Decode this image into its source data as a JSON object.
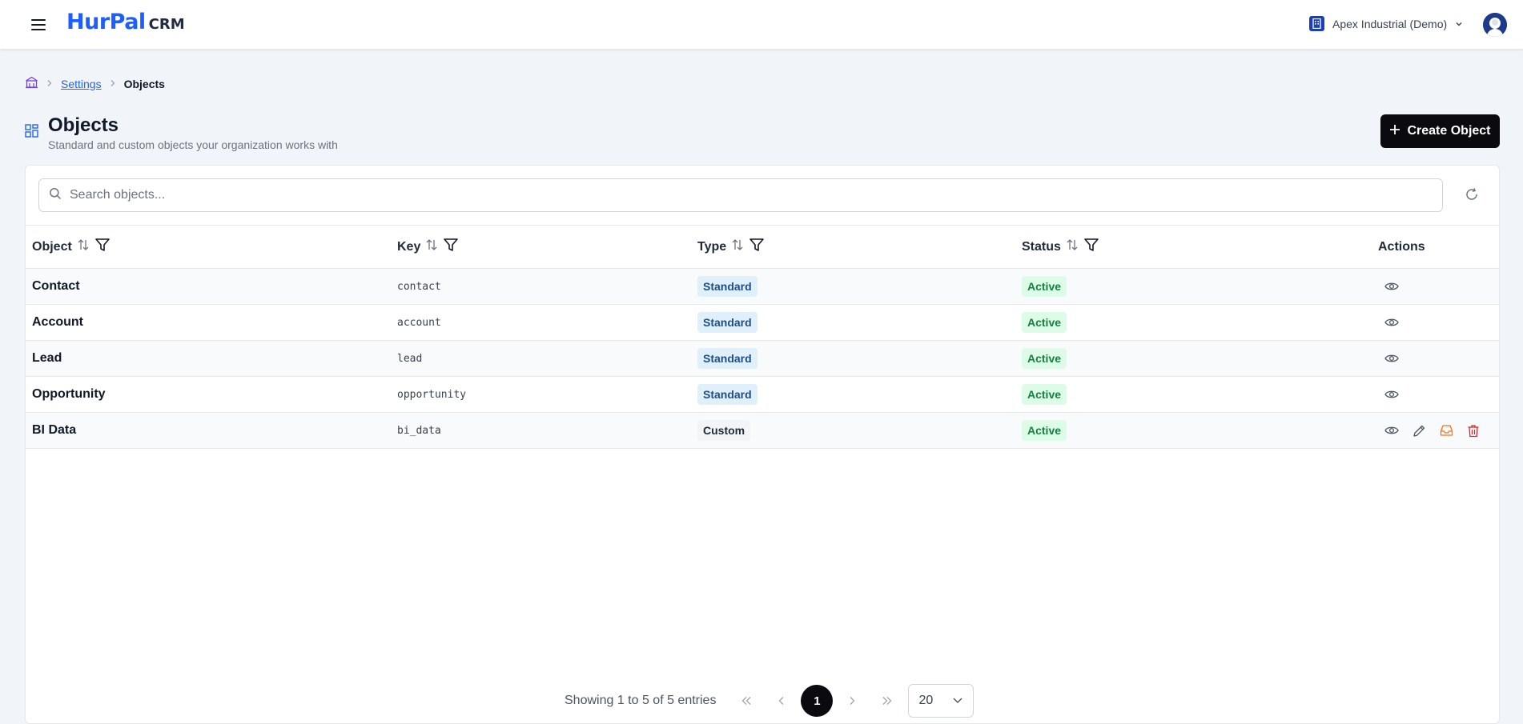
{
  "header": {
    "logo_brand": "HurPal",
    "logo_suffix": "CRM",
    "org_name": "Apex Industrial (Demo)"
  },
  "breadcrumb": {
    "settings": "Settings",
    "current": "Objects"
  },
  "page": {
    "title": "Objects",
    "subtitle": "Standard and custom objects your organization works with",
    "create_label": "Create Object"
  },
  "search": {
    "placeholder": "Search objects...",
    "value": ""
  },
  "table": {
    "columns": [
      "Object",
      "Key",
      "Type",
      "Status",
      "Actions"
    ],
    "rows": [
      {
        "name": "Contact",
        "key": "contact",
        "type": "Standard",
        "status": "Active",
        "actions": [
          "eye-icon"
        ]
      },
      {
        "name": "Account",
        "key": "account",
        "type": "Standard",
        "status": "Active",
        "actions": [
          "eye-icon"
        ]
      },
      {
        "name": "Lead",
        "key": "lead",
        "type": "Standard",
        "status": "Active",
        "actions": [
          "eye-icon"
        ]
      },
      {
        "name": "Opportunity",
        "key": "opportunity",
        "type": "Standard",
        "status": "Active",
        "actions": [
          "eye-icon"
        ]
      },
      {
        "name": "BI Data",
        "key": "bi_data",
        "type": "Custom",
        "status": "Active",
        "actions": [
          "eye-icon",
          "pencil-icon",
          "inbox-icon",
          "trash-icon"
        ]
      }
    ]
  },
  "pagination": {
    "info": "Showing 1 to 5 of 5 entries",
    "current_page": "1",
    "page_size": "20"
  },
  "colors": {
    "brand": "#1e5eff",
    "standard_badge_bg": "#e0f0fb",
    "active_badge_bg": "#dcfce7",
    "archive_icon": "#f97316",
    "delete_icon": "#dc2626"
  }
}
